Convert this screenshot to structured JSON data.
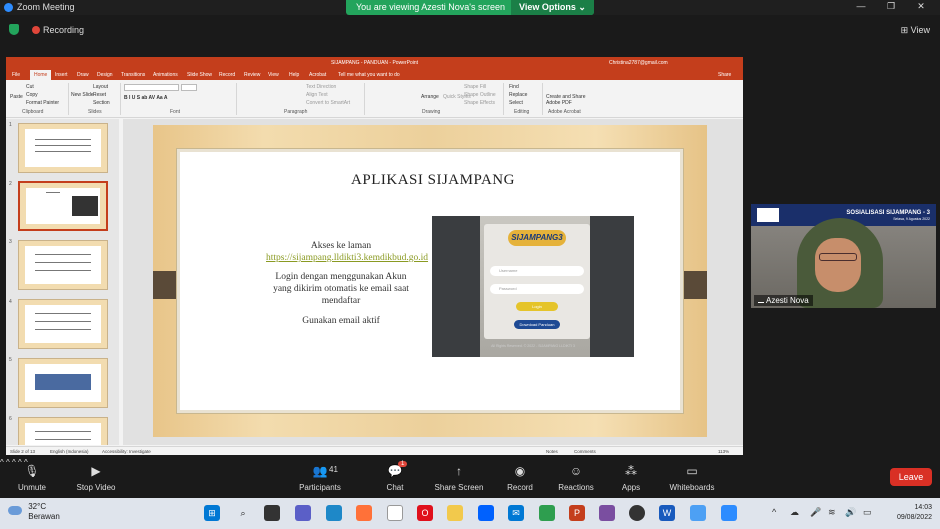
{
  "zoom": {
    "window_title": "Zoom Meeting",
    "viewing_message": "You are viewing Azesti Nova's screen",
    "view_options": "View Options",
    "view_options_caret": "⌄",
    "recording": "Recording",
    "view_button": "View",
    "view_icon": "⊞",
    "win_minimize": "—",
    "win_maximize": "❐",
    "win_close": "✕"
  },
  "ppt": {
    "title": "SIJAMPANG - PANDUAN - PowerPoint",
    "user": "Christina2787@gmail.com",
    "tabs": [
      "File",
      "Home",
      "Insert",
      "Draw",
      "Design",
      "Transitions",
      "Animations",
      "Slide Show",
      "Record",
      "Review",
      "View",
      "Help",
      "Acrobat",
      "Tell me what you want to do"
    ],
    "share": "Share",
    "ribbon": {
      "paste": "Paste",
      "cut": "Cut",
      "copy": "Copy",
      "format_painter": "Format Painter",
      "new_slide": "New Slide",
      "layout": "Layout",
      "reset": "Reset",
      "section": "Section",
      "text_direction": "Text Direction",
      "align_text": "Align Text",
      "smartart": "Convert to SmartArt",
      "arrange": "Arrange",
      "quick_styles": "Quick Styles",
      "shape_fill": "Shape Fill",
      "shape_outline": "Shape Outline",
      "shape_effects": "Shape Effects",
      "find": "Find",
      "replace": "Replace",
      "select": "Select",
      "create_share": "Create and Share Adobe PDF",
      "groups": [
        "Clipboard",
        "Slides",
        "Font",
        "Paragraph",
        "Drawing",
        "Editing",
        "Adobe Acrobat"
      ]
    },
    "thumb_numbers": [
      "1",
      "2",
      "3",
      "4",
      "5",
      "6"
    ],
    "status": {
      "slide": "Slide 2 of 13",
      "language": "English (Indonesia)",
      "accessibility": "Accessibility: Investigate",
      "notes": "Notes",
      "comments": "Comments",
      "zoom": "113%"
    }
  },
  "slide": {
    "title": "APLIKASI SIJAMPANG",
    "access_prefix": "Akses ke laman ",
    "access_link": "https://sijampang.lldikti3.kemdikbud.go.id",
    "login_text": "Login dengan menggunakan Akun yang dikirim otomatis ke email saat mendaftar",
    "email_text": "Gunakan email aktif",
    "app_logo": "SIJAMPANG3",
    "username_placeholder": "Username",
    "password_placeholder": "Password",
    "login_button": "Login",
    "download_button": "Download Panduan",
    "app_footer": "All Rights Reserved. © 2022 - SIJAMPANG LLDIKTI 3"
  },
  "participant": {
    "name": "Azesti Nova",
    "banner": "SOSIALISASI SIJAMPANG - 3",
    "banner_date": "Selasa, 9 Agustus 2022"
  },
  "toolbar": {
    "unmute": "Unmute",
    "stop_video": "Stop Video",
    "participants": "Participants",
    "participants_count": "41",
    "chat": "Chat",
    "chat_badge": "1",
    "share_screen": "Share Screen",
    "record": "Record",
    "reactions": "Reactions",
    "apps": "Apps",
    "whiteboards": "Whiteboards",
    "leave": "Leave"
  },
  "taskbar": {
    "temperature": "32°C",
    "weather": "Berawan",
    "time": "14:03",
    "date": "09/08/2022"
  }
}
